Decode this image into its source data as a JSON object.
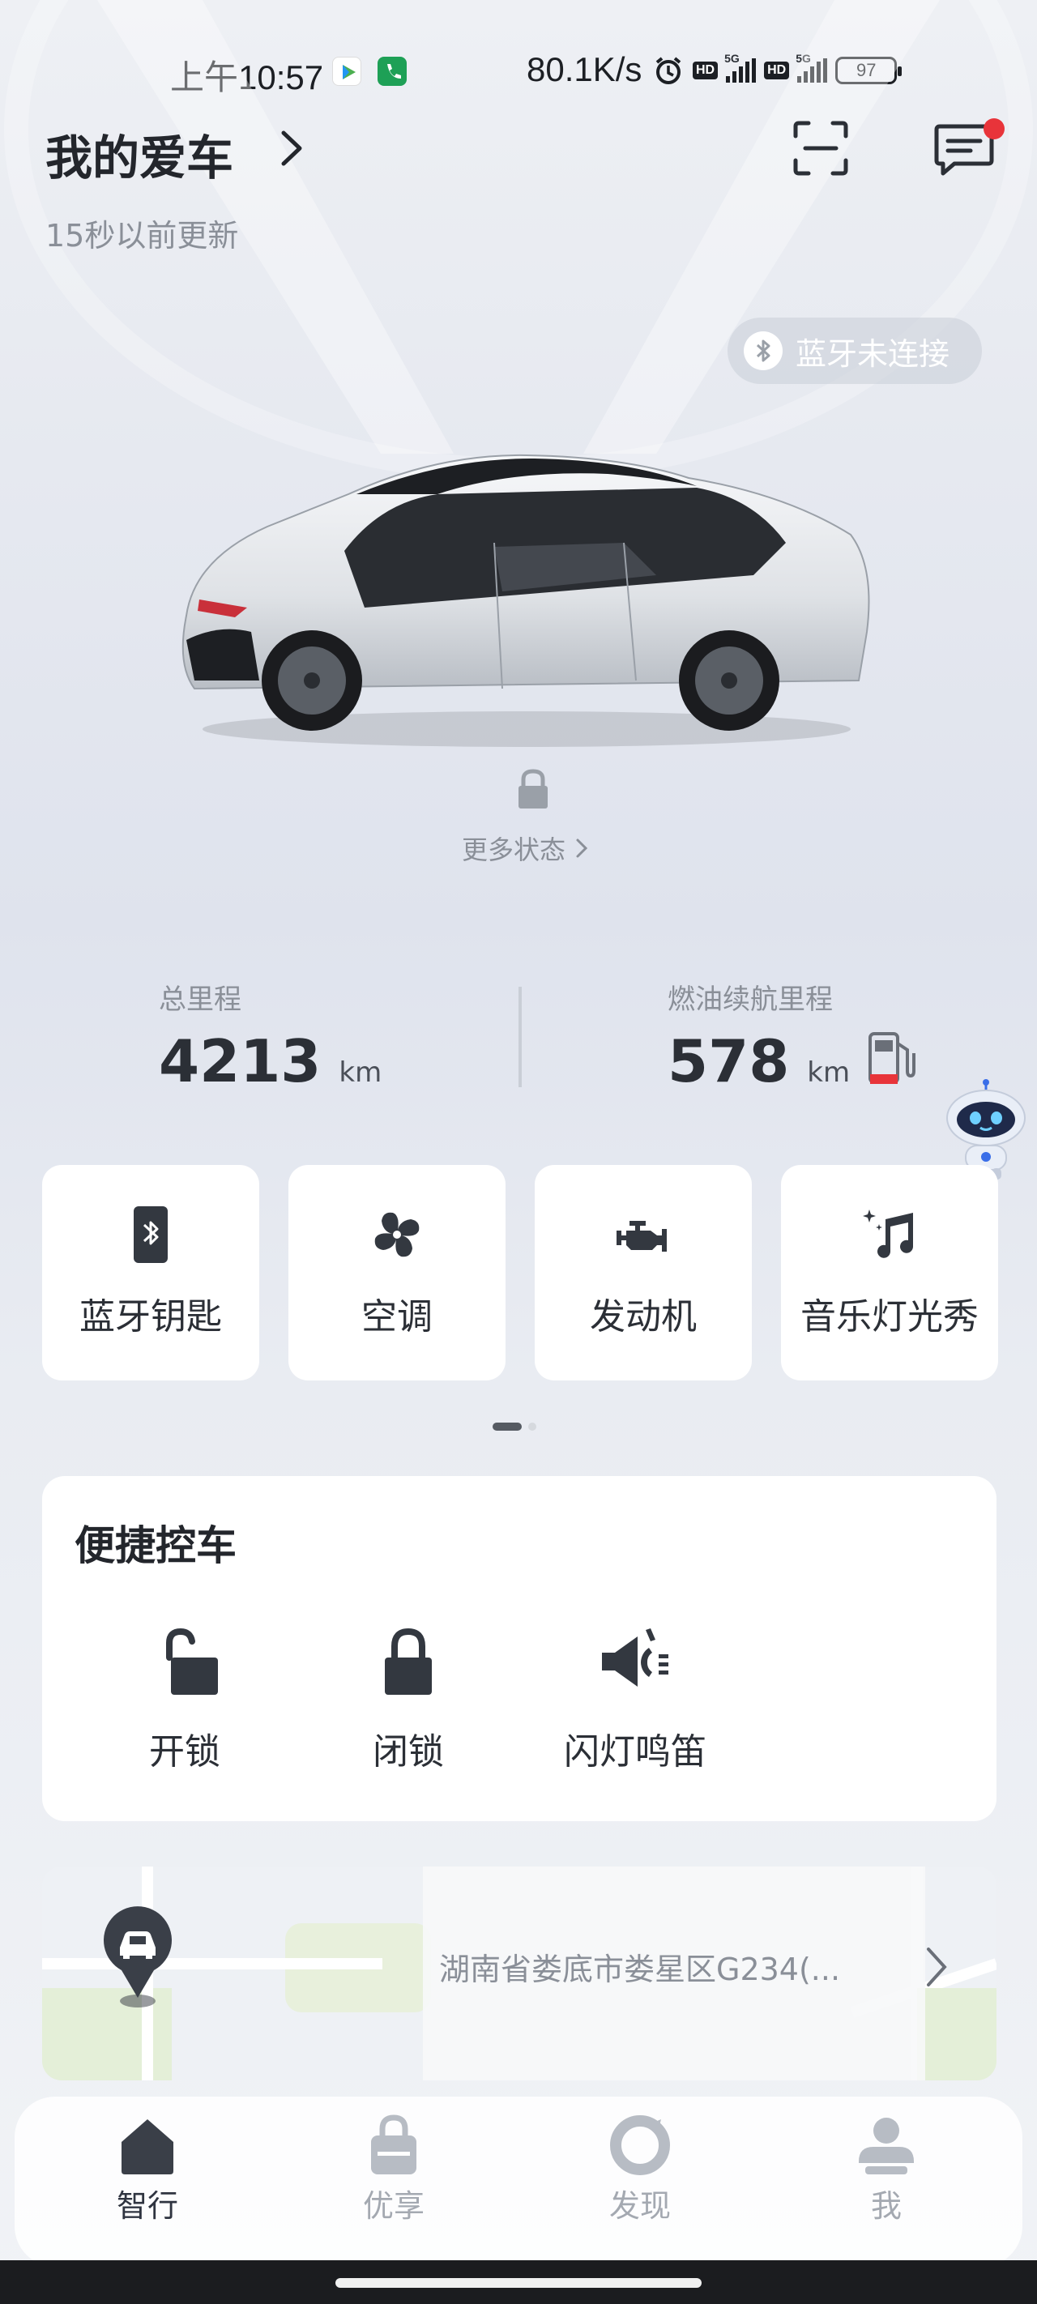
{
  "status_bar": {
    "time": "上午10:57",
    "net_speed": "80.1K/s",
    "hd": "HD",
    "network_type": "5G",
    "battery": "97"
  },
  "header": {
    "title": "我的爱车",
    "updated": "15秒以前更新"
  },
  "vehicle": {
    "bluetooth_status": "蓝牙未连接",
    "more_status": "更多状态"
  },
  "mileage": {
    "total_label": "总里程",
    "total_value": "4213",
    "total_unit": "km",
    "range_label": "燃油续航里程",
    "range_value": "578",
    "range_unit": "km"
  },
  "quick_tiles": [
    {
      "label": "蓝牙钥匙",
      "icon": "bluetooth-key-icon"
    },
    {
      "label": "空调",
      "icon": "fan-icon"
    },
    {
      "label": "发动机",
      "icon": "engine-icon"
    },
    {
      "label": "音乐灯光秀",
      "icon": "music-icon"
    }
  ],
  "quick_control": {
    "title": "便捷控车",
    "items": [
      {
        "label": "开锁",
        "icon": "unlock-icon"
      },
      {
        "label": "闭锁",
        "icon": "lock-icon"
      },
      {
        "label": "闪灯鸣笛",
        "icon": "horn-icon"
      }
    ]
  },
  "location": {
    "address": "湖南省娄底市娄星区G234(..."
  },
  "bottom_nav": {
    "active": "智行",
    "items": [
      {
        "label": "智行",
        "icon": "home-icon"
      },
      {
        "label": "优享",
        "icon": "bag-icon"
      },
      {
        "label": "发现",
        "icon": "discover-icon"
      },
      {
        "label": "我",
        "icon": "person-icon"
      }
    ]
  },
  "colors": {
    "accent_dark": "#3a3f48",
    "notification": "#e8343a",
    "fuel_low": "#e8343a"
  }
}
